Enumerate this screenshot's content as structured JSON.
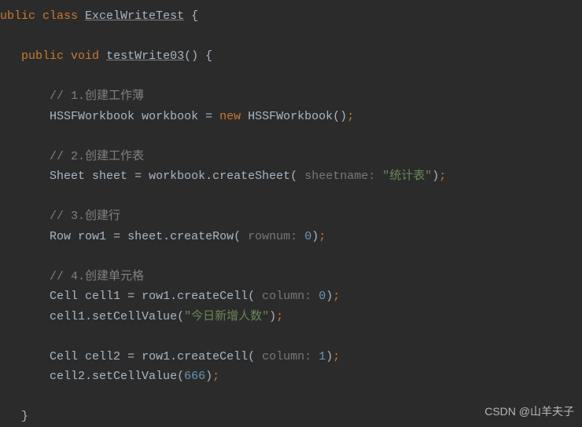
{
  "code": {
    "line1_kw1": "ublic class",
    "line1_classname": "ExcelWriteTest",
    "line1_brace": "{",
    "line2_kw1": "public void",
    "line2_method": "testWrite03",
    "line2_paren": "()",
    "line2_brace": "{",
    "comment1": "// 1.创建工作薄",
    "line3_type": "HSSFWorkbook",
    "line3_var": "workbook",
    "line3_eq": "=",
    "line3_new": "new",
    "line3_ctor": "HSSFWorkbook()",
    "line3_semi": ";",
    "comment2": "// 2.创建工作表",
    "line4_type": "Sheet",
    "line4_var": "sheet",
    "line4_eq": "=",
    "line4_obj": "workbook",
    "line4_dot": ".",
    "line4_method": "createSheet",
    "line4_lparen": "(",
    "line4_hint": " sheetname: ",
    "line4_str": "\"统计表\"",
    "line4_rparen": ")",
    "line4_semi": ";",
    "comment3": "// 3.创建行",
    "line5_type": "Row",
    "line5_var": "row1",
    "line5_eq": "=",
    "line5_obj": "sheet",
    "line5_dot": ".",
    "line5_method": "createRow",
    "line5_lparen": "(",
    "line5_hint": " rownum: ",
    "line5_num": "0",
    "line5_rparen": ")",
    "line5_semi": ";",
    "comment4": "// 4.创建单元格",
    "line6_type": "Cell",
    "line6_var": "cell1",
    "line6_eq": "=",
    "line6_obj": "row1",
    "line6_dot": ".",
    "line6_method": "createCell",
    "line6_lparen": "(",
    "line6_hint": " column: ",
    "line6_num": "0",
    "line6_rparen": ")",
    "line6_semi": ";",
    "line7_obj": "cell1",
    "line7_dot": ".",
    "line7_method": "setCellValue",
    "line7_lparen": "(",
    "line7_str": "\"今日新增人数\"",
    "line7_rparen": ")",
    "line7_semi": ";",
    "line8_type": "Cell",
    "line8_var": "cell2",
    "line8_eq": "=",
    "line8_obj": "row1",
    "line8_dot": ".",
    "line8_method": "createCell",
    "line8_lparen": "(",
    "line8_hint": " column: ",
    "line8_num": "1",
    "line8_rparen": ")",
    "line8_semi": ";",
    "line9_obj": "cell2",
    "line9_dot": ".",
    "line9_method": "setCellValue",
    "line9_lparen": "(",
    "line9_num": "666",
    "line9_rparen": ")",
    "line9_semi": ";",
    "closebrace": "}"
  },
  "watermark": "CSDN @山羊夫子"
}
